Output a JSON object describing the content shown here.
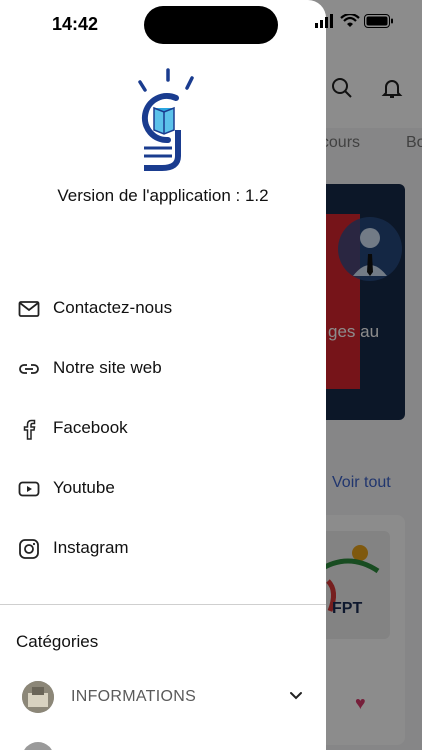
{
  "status_bar": {
    "time": "14:42"
  },
  "drawer": {
    "version_text": "Version de l'application : 1.2",
    "menu": [
      {
        "label": "Contactez-nous",
        "icon": "mail-icon"
      },
      {
        "label": "Notre site web",
        "icon": "link-icon"
      },
      {
        "label": "Facebook",
        "icon": "facebook-icon"
      },
      {
        "label": "Youtube",
        "icon": "youtube-icon"
      },
      {
        "label": "Instagram",
        "icon": "instagram-icon"
      }
    ],
    "categories_title": "Catégories",
    "categories": [
      {
        "label": "INFORMATIONS"
      }
    ]
  },
  "background": {
    "tabs": [
      "ncours",
      "Bo"
    ],
    "banner_text": "ges au",
    "see_all": "Voir tout",
    "card_logo_text": "FPT"
  },
  "colors": {
    "accent": "#3d63c9",
    "logo_blue": "#1a3c8f",
    "logo_light_blue": "#2aa7e0",
    "heart": "#d83a6b"
  }
}
